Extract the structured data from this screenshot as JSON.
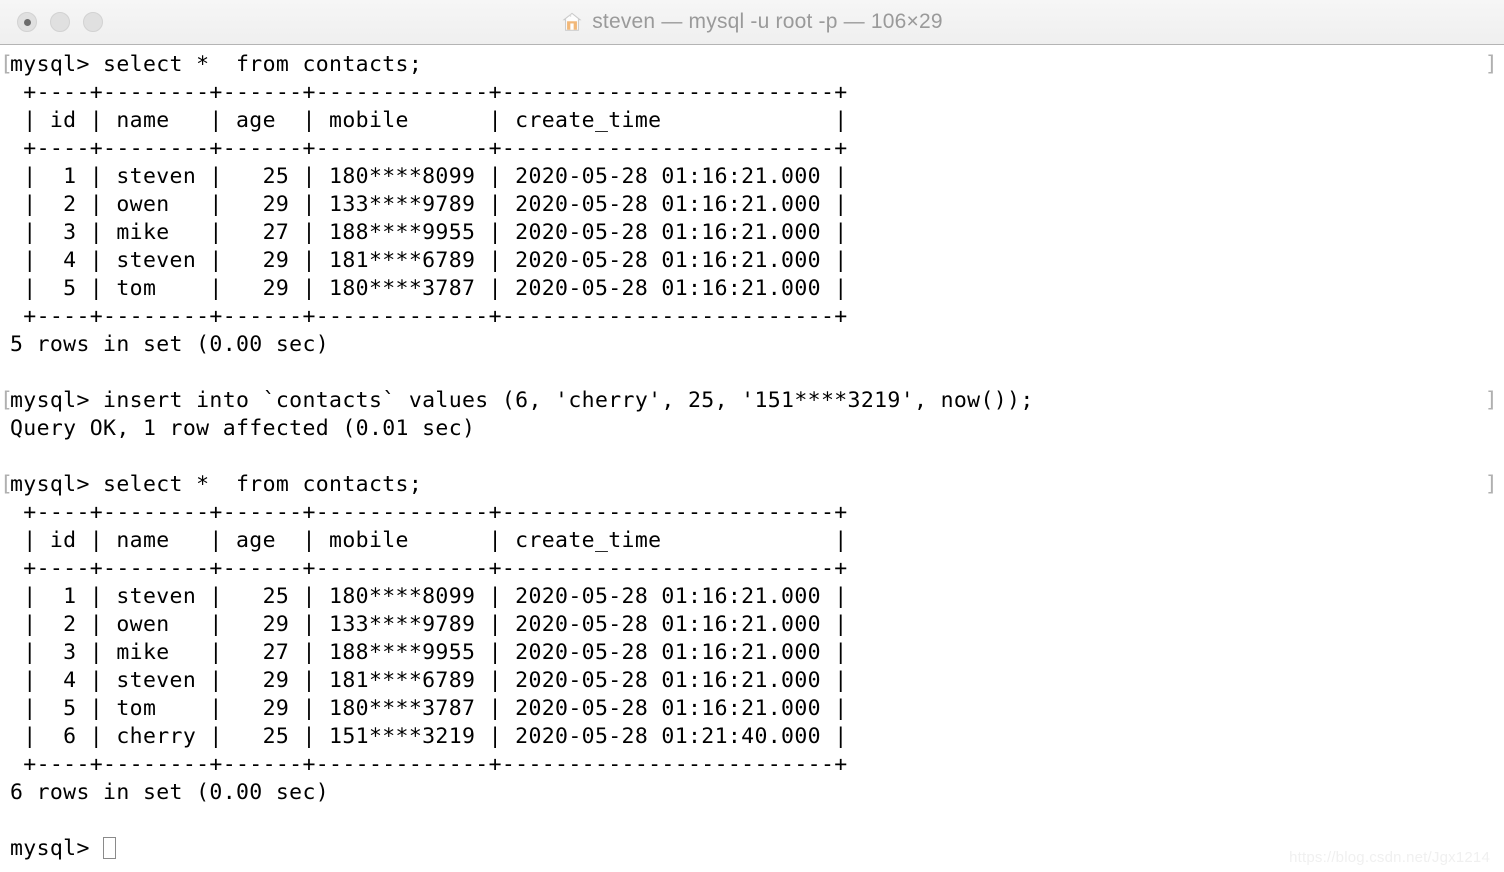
{
  "window": {
    "title": "steven — mysql -u root -p — 106×29",
    "title_icon": "home-icon",
    "traffic_lights": [
      {
        "name": "close-button",
        "label": ""
      },
      {
        "name": "minimize-button",
        "label": ""
      },
      {
        "name": "zoom-button",
        "label": ""
      }
    ]
  },
  "terminal": {
    "prompt_mark_left": "[",
    "prompt_mark_right": "]",
    "cursor": "block-cursor",
    "lines": [
      {
        "type": "prompt",
        "text": "mysql> select *  from contacts;"
      },
      {
        "type": "out",
        "text": " +----+--------+------+-------------+-------------------------+"
      },
      {
        "type": "out",
        "text": " | id | name   | age  | mobile      | create_time             |"
      },
      {
        "type": "out",
        "text": " +----+--------+------+-------------+-------------------------+"
      },
      {
        "type": "out",
        "text": " |  1 | steven |   25 | 180****8099 | 2020-05-28 01:16:21.000 |"
      },
      {
        "type": "out",
        "text": " |  2 | owen   |   29 | 133****9789 | 2020-05-28 01:16:21.000 |"
      },
      {
        "type": "out",
        "text": " |  3 | mike   |   27 | 188****9955 | 2020-05-28 01:16:21.000 |"
      },
      {
        "type": "out",
        "text": " |  4 | steven |   29 | 181****6789 | 2020-05-28 01:16:21.000 |"
      },
      {
        "type": "out",
        "text": " |  5 | tom    |   29 | 180****3787 | 2020-05-28 01:16:21.000 |"
      },
      {
        "type": "out",
        "text": " +----+--------+------+-------------+-------------------------+"
      },
      {
        "type": "out",
        "text": "5 rows in set (0.00 sec)"
      },
      {
        "type": "blank",
        "text": " "
      },
      {
        "type": "prompt",
        "text": "mysql> insert into `contacts` values (6, 'cherry', 25, '151****3219', now());"
      },
      {
        "type": "out",
        "text": "Query OK, 1 row affected (0.01 sec)"
      },
      {
        "type": "blank",
        "text": " "
      },
      {
        "type": "prompt",
        "text": "mysql> select *  from contacts;"
      },
      {
        "type": "out",
        "text": " +----+--------+------+-------------+-------------------------+"
      },
      {
        "type": "out",
        "text": " | id | name   | age  | mobile      | create_time             |"
      },
      {
        "type": "out",
        "text": " +----+--------+------+-------------+-------------------------+"
      },
      {
        "type": "out",
        "text": " |  1 | steven |   25 | 180****8099 | 2020-05-28 01:16:21.000 |"
      },
      {
        "type": "out",
        "text": " |  2 | owen   |   29 | 133****9789 | 2020-05-28 01:16:21.000 |"
      },
      {
        "type": "out",
        "text": " |  3 | mike   |   27 | 188****9955 | 2020-05-28 01:16:21.000 |"
      },
      {
        "type": "out",
        "text": " |  4 | steven |   29 | 181****6789 | 2020-05-28 01:16:21.000 |"
      },
      {
        "type": "out",
        "text": " |  5 | tom    |   29 | 180****3787 | 2020-05-28 01:16:21.000 |"
      },
      {
        "type": "out",
        "text": " |  6 | cherry |   25 | 151****3219 | 2020-05-28 01:21:40.000 |"
      },
      {
        "type": "out",
        "text": " +----+--------+------+-------------+-------------------------+"
      },
      {
        "type": "out",
        "text": "6 rows in set (0.00 sec)"
      },
      {
        "type": "blank",
        "text": " "
      },
      {
        "type": "cursorline",
        "text": "mysql> "
      }
    ]
  },
  "result_tables": [
    {
      "columns": [
        "id",
        "name",
        "age",
        "mobile",
        "create_time"
      ],
      "rows": [
        [
          "1",
          "steven",
          "25",
          "180****8099",
          "2020-05-28 01:16:21.000"
        ],
        [
          "2",
          "owen",
          "29",
          "133****9789",
          "2020-05-28 01:16:21.000"
        ],
        [
          "3",
          "mike",
          "27",
          "188****9955",
          "2020-05-28 01:16:21.000"
        ],
        [
          "4",
          "steven",
          "29",
          "181****6789",
          "2020-05-28 01:16:21.000"
        ],
        [
          "5",
          "tom",
          "29",
          "180****3787",
          "2020-05-28 01:16:21.000"
        ]
      ],
      "footer": "5 rows in set (0.00 sec)"
    },
    {
      "columns": [
        "id",
        "name",
        "age",
        "mobile",
        "create_time"
      ],
      "rows": [
        [
          "1",
          "steven",
          "25",
          "180****8099",
          "2020-05-28 01:16:21.000"
        ],
        [
          "2",
          "owen",
          "29",
          "133****9789",
          "2020-05-28 01:16:21.000"
        ],
        [
          "3",
          "mike",
          "27",
          "188****9955",
          "2020-05-28 01:16:21.000"
        ],
        [
          "4",
          "steven",
          "29",
          "181****6789",
          "2020-05-28 01:16:21.000"
        ],
        [
          "5",
          "tom",
          "29",
          "180****3787",
          "2020-05-28 01:16:21.000"
        ],
        [
          "6",
          "cherry",
          "25",
          "151****3219",
          "2020-05-28 01:21:40.000"
        ]
      ],
      "footer": "6 rows in set (0.00 sec)"
    }
  ],
  "watermark": {
    "text": "https://blog.csdn.net/Jgx1214"
  },
  "colors": {
    "terminal_bg": "#ffffff",
    "terminal_fg": "#000000",
    "titlebar_bg": "#f2f2f2",
    "title_fg": "#9a9a9a",
    "prompt_mark": "#b0b0b0",
    "cursor_outline": "#8a8a8a",
    "watermark_fg": "#f0f0f0"
  }
}
